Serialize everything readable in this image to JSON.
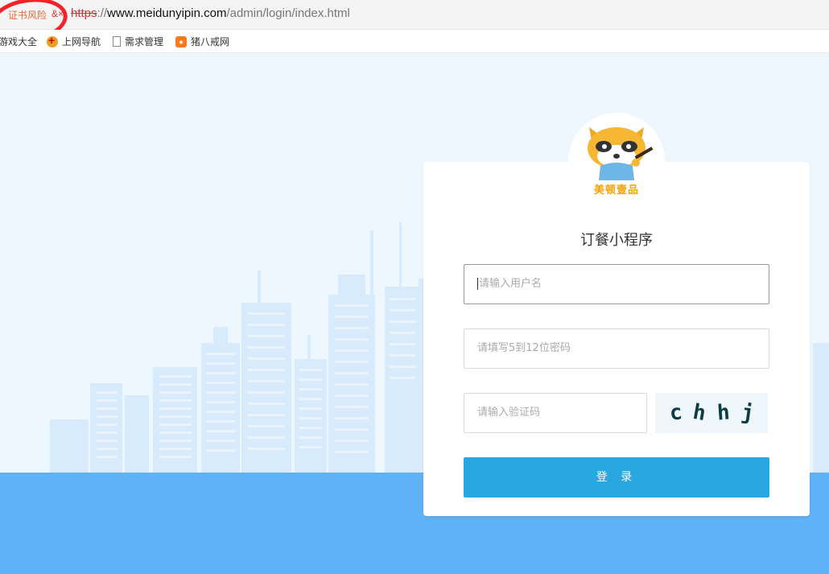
{
  "browser": {
    "security_warning": "证书风险",
    "security_warning_x": "&×",
    "url_scheme": "https",
    "url_sep": "://",
    "url_host": "www.meidunyipin.com",
    "url_path": "/admin/login/index.html"
  },
  "bookmarks": [
    {
      "label": "游戏大全",
      "icon": "game-icon"
    },
    {
      "label": "上网导航",
      "icon": "nav-icon"
    },
    {
      "label": "需求管理",
      "icon": "document-icon"
    },
    {
      "label": "猪八戒网",
      "icon": "pig-icon"
    }
  ],
  "login": {
    "logo_text": "美顿壹品",
    "title": "订餐小程序",
    "username_placeholder": "请输入用户名",
    "password_placeholder": "请填写5到12位密码",
    "captcha_placeholder": "请输入验证码",
    "captcha_chars": [
      "c",
      "h",
      "h",
      "j"
    ],
    "submit_label": "登 录"
  },
  "colors": {
    "accent": "#29a7e1",
    "ground": "#5fb1f8",
    "background": "#eef6fe",
    "warning_circle": "#f4232a"
  }
}
